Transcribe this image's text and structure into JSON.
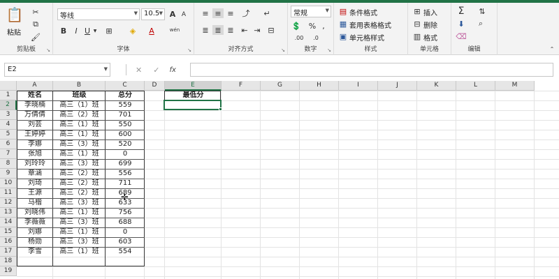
{
  "ribbon": {
    "clipboard": {
      "label": "剪贴板",
      "paste": "粘贴"
    },
    "font": {
      "label": "字体",
      "font_name": "等线",
      "font_size": "10.5",
      "bold": "B",
      "italic": "I",
      "underline": "U",
      "grow": "A",
      "shrink": "A",
      "font_color_letter": "A",
      "wen": "wén"
    },
    "alignment": {
      "label": "对齐方式"
    },
    "number": {
      "label": "数字",
      "format": "常规"
    },
    "styles": {
      "label": "样式",
      "conditional": "条件格式",
      "table_format": "套用表格格式",
      "cell_styles": "单元格样式"
    },
    "cells": {
      "label": "单元格",
      "insert": "插入",
      "delete": "删除",
      "format": "格式"
    },
    "editing": {
      "label": "编辑"
    }
  },
  "formula_bar": {
    "name_box": "E2",
    "fx": "fx",
    "formula": ""
  },
  "columns": [
    "A",
    "B",
    "C",
    "D",
    "E",
    "F",
    "G",
    "H",
    "I",
    "J",
    "K",
    "L",
    "M"
  ],
  "rows": [
    "1",
    "2",
    "3",
    "4",
    "5",
    "6",
    "7",
    "8",
    "9",
    "10",
    "11",
    "12",
    "13",
    "14",
    "15",
    "16",
    "17",
    "18",
    "19"
  ],
  "table": {
    "headers": [
      "姓名",
      "班级",
      "总分"
    ],
    "rows": [
      [
        "李晓楠",
        "高三（1）班",
        "559"
      ],
      [
        "万倩倩",
        "高三（2）班",
        "701"
      ],
      [
        "刘芸",
        "高三（1）班",
        "550"
      ],
      [
        "王婷婷",
        "高三（1）班",
        "600"
      ],
      [
        "李娜",
        "高三（3）班",
        "520"
      ],
      [
        "张旭",
        "高三（1）班",
        "0"
      ],
      [
        "刘玲玲",
        "高三（3）班",
        "699"
      ],
      [
        "章涵",
        "高三（2）班",
        "556"
      ],
      [
        "刘琦",
        "高三（2）班",
        "711"
      ],
      [
        "王源",
        "高三（2）班",
        "689"
      ],
      [
        "马楷",
        "高三（3）班",
        "633"
      ],
      [
        "刘晓伟",
        "高三（1）班",
        "756"
      ],
      [
        "李薇薇",
        "高三（3）班",
        "688"
      ],
      [
        "刘娜",
        "高三（1）班",
        "0"
      ],
      [
        "杨勋",
        "高三（3）班",
        "603"
      ],
      [
        "李雪",
        "高三（1）班",
        "554"
      ]
    ]
  },
  "min_box": {
    "header": "最低分",
    "value": ""
  },
  "colors": {
    "accent": "#217346",
    "font_red": "#c00000",
    "highlight_yellow": "#ffd700"
  }
}
